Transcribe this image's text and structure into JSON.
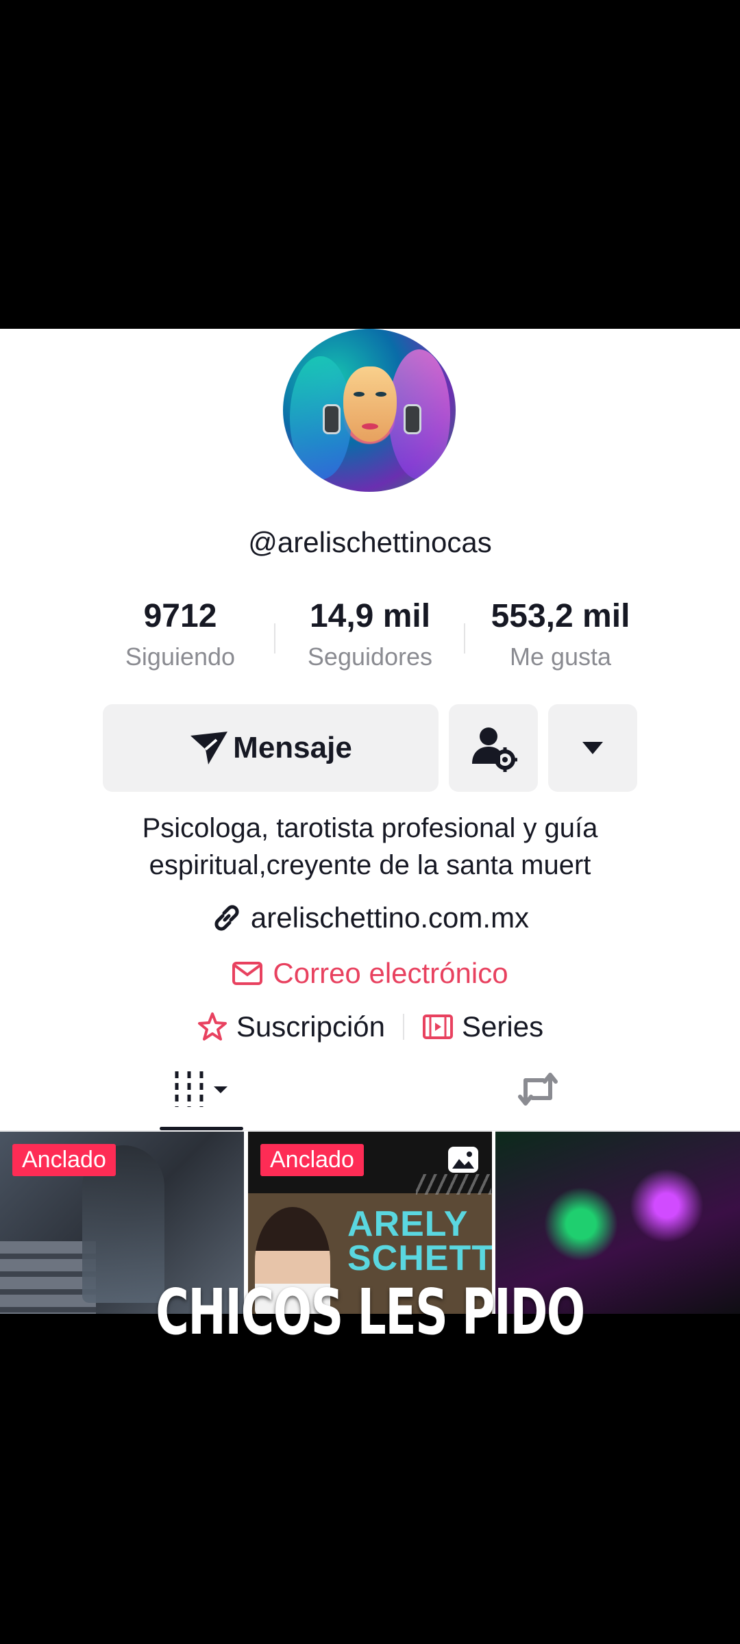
{
  "profile": {
    "username": "@arelischettinocas",
    "bio": "Psicologa, tarotista profesional y guía espiritual,creyente de la santa muert",
    "link": "arelischettino.com.mx",
    "email_label": "Correo electrónico",
    "subscription_label": "Suscripción",
    "series_label": "Series"
  },
  "stats": [
    {
      "value": "9712",
      "label": "Siguiendo"
    },
    {
      "value": "14,9 mil",
      "label": "Seguidores"
    },
    {
      "value": "553,2 mil",
      "label": "Me gusta"
    }
  ],
  "actions": {
    "message_label": "Mensaje",
    "user_settings_icon": "user-gear-icon",
    "more_icon": "caret-down-icon"
  },
  "tabs": [
    {
      "name": "videos",
      "icon": "grid-bars-icon",
      "active": true
    },
    {
      "name": "reposts",
      "icon": "repost-icon",
      "active": false
    }
  ],
  "videos": [
    {
      "badge": "Anclado"
    },
    {
      "badge": "Anclado",
      "overlay_text": "ARELY SCHETTINO"
    },
    {}
  ],
  "caption": "CHICOS LES PIDO",
  "colors": {
    "accent": "#fe2c55",
    "email_text": "#e8415f",
    "text": "#161823",
    "muted": "#8a8b91",
    "button_bg": "#f1f1f2"
  }
}
